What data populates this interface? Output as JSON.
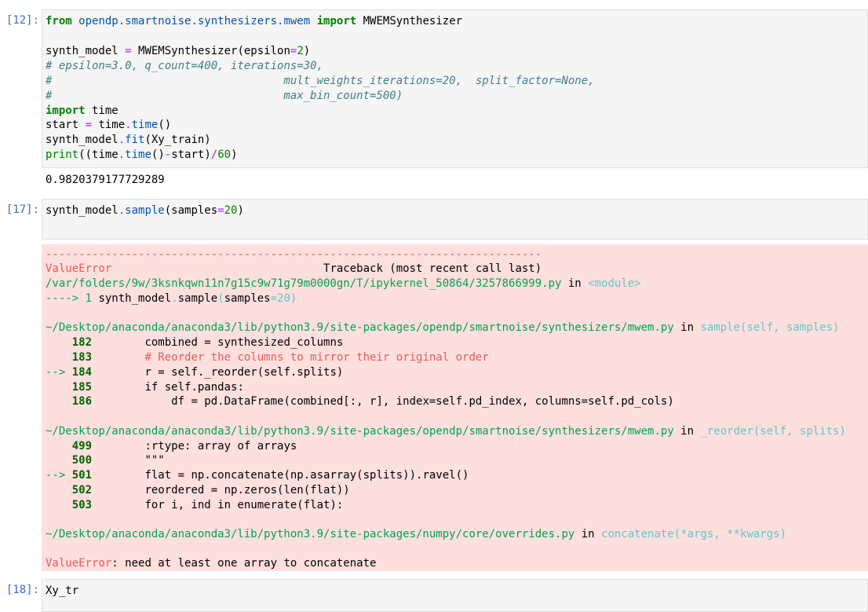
{
  "cell12": {
    "prompt": "[12]:",
    "code": {
      "l1_from": "from",
      "l1_mod": "opendp.smartnoise.synthesizers.mwem",
      "l1_import": "import",
      "l1_name": "MWEMSynthesizer",
      "l3_a": "synth_model ",
      "l3_eq": "=",
      "l3_b": " MWEMSynthesizer(epsilon",
      "l3_eq2": "=",
      "l3_num": "2",
      "l3_c": ")",
      "l4": "# epsilon=3.0, q_count=400, iterations=30,",
      "l5": "#                                   mult_weights_iterations=20,  split_factor=None,",
      "l6": "#                                   max_bin_count=500)",
      "l7_kw": "import",
      "l7_rest": " time",
      "l8_a": "start ",
      "l8_eq": "=",
      "l8_b": " time",
      "l8_dot": ".",
      "l8_fn": "time",
      "l8_c": "()",
      "l9_a": "synth_model",
      "l9_dot": ".",
      "l9_fn": "fit",
      "l9_b": "(Xy_train)",
      "l10_print": "print",
      "l10_a": "((time",
      "l10_dot": ".",
      "l10_fn": "time",
      "l10_b": "()",
      "l10_op": "-",
      "l10_c": "start)",
      "l10_op2": "/",
      "l10_num": "60",
      "l10_d": ")"
    },
    "output": "0.9820379177729289"
  },
  "cell17": {
    "prompt": "[17]:",
    "code": {
      "a": "synth_model",
      "dot": ".",
      "fn": "sample",
      "b": "(samples",
      "eq": "=",
      "num": "20",
      "c": ")"
    },
    "traceback": {
      "dashes": "---------------------------------------------------------------------------",
      "err_name": "ValueError",
      "tb_header": "                                Traceback (most recent call last)",
      "file1": "/var/folders/9w/3ksnkqwn11n7g15c9w71g79m0000gn/T/ipykernel_50864/3257866999.py",
      "in1": " in ",
      "mod1": "<module>",
      "arrow1": "----> 1 ",
      "line1_a": "synth_model",
      "line1_dot": ".",
      "line1_fn": "sample",
      "line1_paren": "(",
      "line1_b": "samples",
      "line1_eq": "=",
      "line1_num": "20",
      "line1_c": ")",
      "file2": "~/Desktop/anaconda/anaconda3/lib/python3.9/site-packages/opendp/smartnoise/synthesizers/mwem.py",
      "in2": " in ",
      "fn2": "sample(self, samples)",
      "f2_lines": [
        {
          "num": "182",
          "arrow": "    ",
          "code": "        combined = synthesized_columns"
        },
        {
          "num": "183",
          "arrow": "    ",
          "code": "        # Reorder the columns to mirror their original order"
        },
        {
          "num": "184",
          "arrow": "--> ",
          "code": "        r = self._reorder(self.splits)"
        },
        {
          "num": "185",
          "arrow": "    ",
          "code": "        if self.pandas:"
        },
        {
          "num": "186",
          "arrow": "    ",
          "code": "            df = pd.DataFrame(combined[:, r], index=self.pd_index, columns=self.pd_cols)"
        }
      ],
      "file3": "~/Desktop/anaconda/anaconda3/lib/python3.9/site-packages/opendp/smartnoise/synthesizers/mwem.py",
      "in3": " in ",
      "fn3": "_reorder(self, splits)",
      "f3_lines": [
        {
          "num": "499",
          "arrow": "    ",
          "code": "        :rtype: array of arrays"
        },
        {
          "num": "500",
          "arrow": "    ",
          "code": "        \"\"\""
        },
        {
          "num": "501",
          "arrow": "--> ",
          "code": "        flat = np.concatenate(np.asarray(splits)).ravel()"
        },
        {
          "num": "502",
          "arrow": "    ",
          "code": "        reordered = np.zeros(len(flat))"
        },
        {
          "num": "503",
          "arrow": "    ",
          "code": "        for i, ind in enumerate(flat):"
        }
      ],
      "file4": "~/Desktop/anaconda/anaconda3/lib/python3.9/site-packages/numpy/core/overrides.py",
      "in4": " in ",
      "fn4": "concatenate(*args, **kwargs)",
      "final_err": "ValueError",
      "final_msg": ": need at least one array to concatenate"
    }
  },
  "cell18": {
    "prompt": "[18]:",
    "code": "Xy_tr"
  }
}
